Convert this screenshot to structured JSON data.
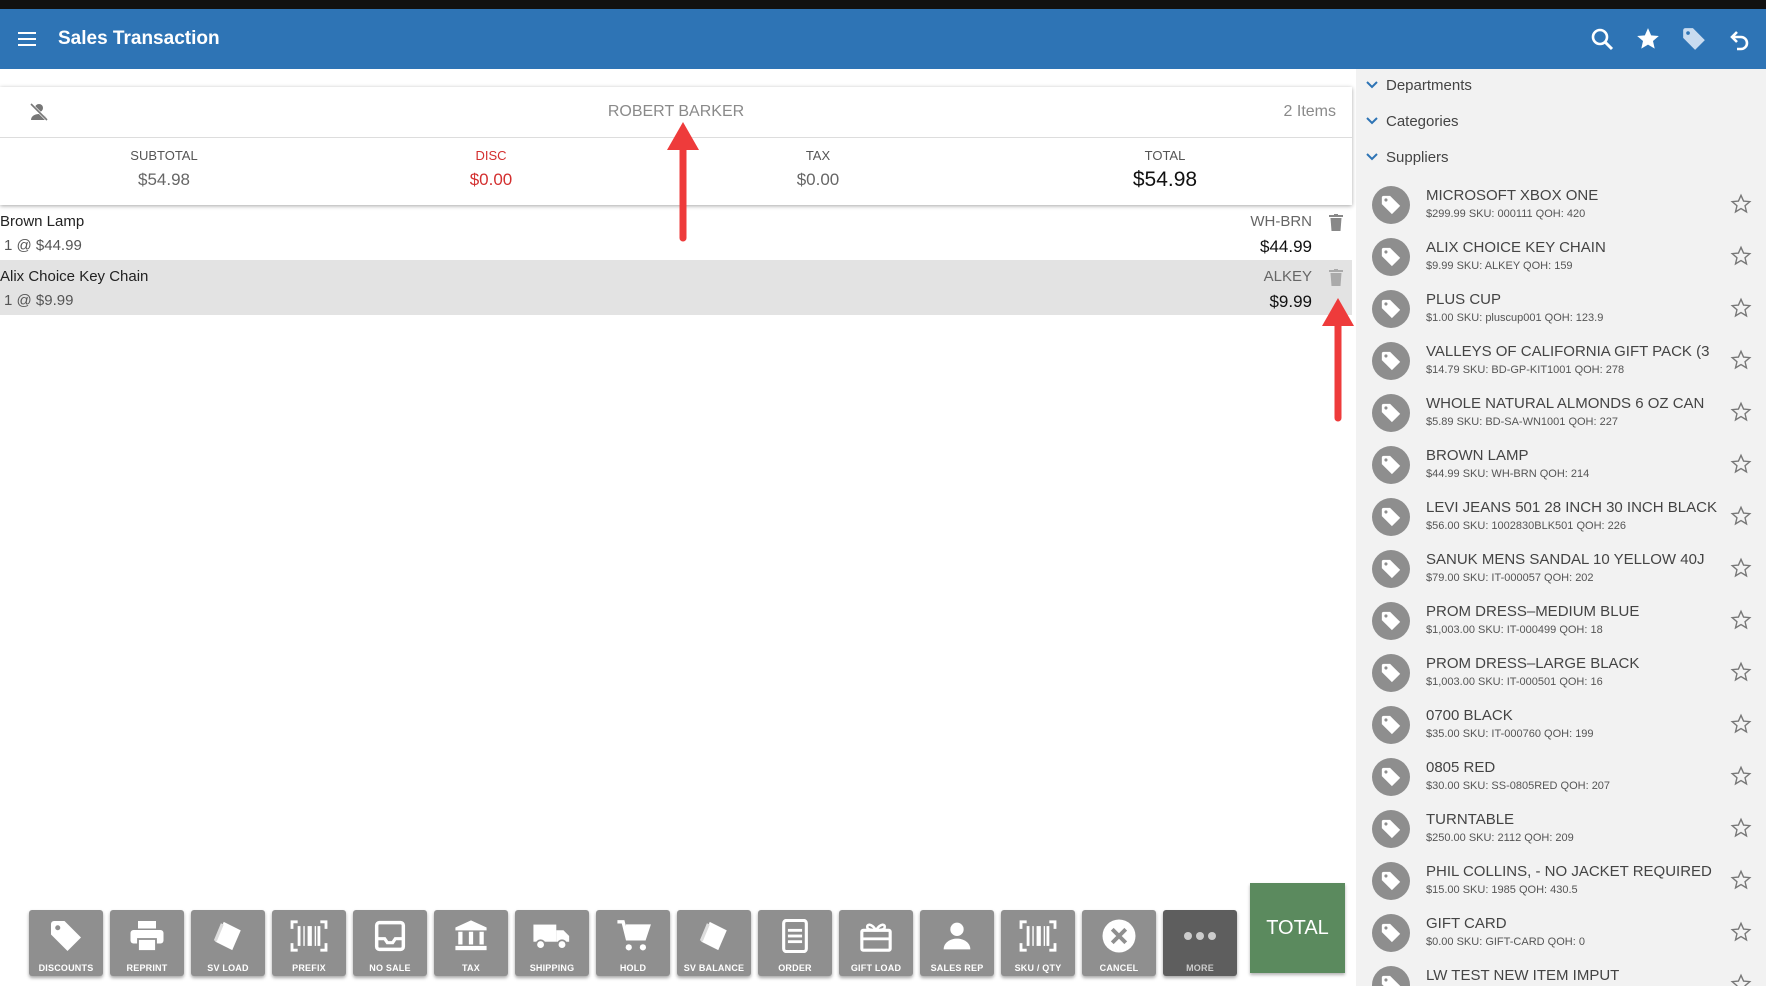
{
  "header": {
    "title": "Sales Transaction",
    "icons": [
      "menu-icon",
      "search-icon",
      "star-icon",
      "tag-icon",
      "undo-icon"
    ]
  },
  "customer": {
    "name": "ROBERT BARKER",
    "item_count": "2 Items"
  },
  "totals": {
    "subtotal_label": "SUBTOTAL",
    "subtotal": "$54.98",
    "disc_label": "DISC",
    "disc": "$0.00",
    "tax_label": "TAX",
    "tax": "$0.00",
    "total_label": "TOTAL",
    "total": "$54.98"
  },
  "lines": [
    {
      "name": "Brown Lamp",
      "qty": "1 @ $44.99",
      "sku": "WH-BRN",
      "price": "$44.99",
      "selected": false
    },
    {
      "name": "Alix Choice Key Chain",
      "qty": "1 @ $9.99",
      "sku": "ALKEY",
      "price": "$9.99",
      "selected": true
    }
  ],
  "toolbar": [
    {
      "label": "DISCOUNTS",
      "icon": "tag-icon"
    },
    {
      "label": "REPRINT",
      "icon": "printer-icon"
    },
    {
      "label": "SV LOAD",
      "icon": "card-icon"
    },
    {
      "label": "PREFIX",
      "icon": "barcode-icon"
    },
    {
      "label": "NO SALE",
      "icon": "tray-icon"
    },
    {
      "label": "TAX",
      "icon": "bank-icon"
    },
    {
      "label": "SHIPPING",
      "icon": "truck-icon"
    },
    {
      "label": "HOLD",
      "icon": "cart-icon"
    },
    {
      "label": "SV BALANCE",
      "icon": "card-icon"
    },
    {
      "label": "ORDER",
      "icon": "document-icon"
    },
    {
      "label": "GIFT LOAD",
      "icon": "gift-icon"
    },
    {
      "label": "SALES REP",
      "icon": "person-icon"
    },
    {
      "label": "SKU / QTY",
      "icon": "barcode-icon"
    },
    {
      "label": "CANCEL",
      "icon": "close-circle-icon"
    },
    {
      "label": "MORE",
      "icon": "more-icon"
    }
  ],
  "total_button": "TOTAL",
  "sidebar": {
    "sections": [
      "Departments",
      "Categories",
      "Suppliers"
    ],
    "products": [
      {
        "name": "MICROSOFT XBOX ONE",
        "detail": "$299.99 SKU: 000111 QOH: 420"
      },
      {
        "name": "ALIX CHOICE KEY CHAIN",
        "detail": "$9.99 SKU: ALKEY QOH: 159"
      },
      {
        "name": "PLUS CUP",
        "detail": "$1.00 SKU: pluscup001 QOH: 123.9"
      },
      {
        "name": "VALLEYS OF CALIFORNIA GIFT PACK (3",
        "detail": "$14.79 SKU: BD-GP-KIT1001 QOH: 278"
      },
      {
        "name": "WHOLE NATURAL ALMONDS 6 OZ CAN",
        "detail": "$5.89 SKU: BD-SA-WN1001 QOH: 227"
      },
      {
        "name": "BROWN LAMP",
        "detail": "$44.99 SKU: WH-BRN QOH: 214"
      },
      {
        "name": "LEVI JEANS 501 28 INCH 30 INCH BLACK",
        "detail": "$56.00 SKU: 1002830BLK501 QOH: 226"
      },
      {
        "name": "SANUK MENS SANDAL 10 YELLOW 40J",
        "detail": "$79.00 SKU: IT-000057 QOH: 202"
      },
      {
        "name": "PROM DRESS–MEDIUM BLUE",
        "detail": "$1,003.00 SKU: IT-000499 QOH: 18"
      },
      {
        "name": "PROM DRESS–LARGE BLACK",
        "detail": "$1,003.00 SKU: IT-000501 QOH: 16"
      },
      {
        "name": "0700 BLACK",
        "detail": "$35.00 SKU: IT-000760 QOH: 199"
      },
      {
        "name": "0805 RED",
        "detail": "$30.00 SKU: SS-0805RED QOH: 207"
      },
      {
        "name": "TURNTABLE",
        "detail": "$250.00 SKU: 2112 QOH: 209"
      },
      {
        "name": "PHIL COLLINS, - NO JACKET REQUIRED",
        "detail": "$15.00 SKU: 1985 QOH: 430.5"
      },
      {
        "name": "GIFT CARD",
        "detail": "$0.00 SKU: GIFT-CARD QOH: 0"
      },
      {
        "name": "LW TEST NEW ITEM IMPUT",
        "detail": ""
      }
    ]
  },
  "colors": {
    "appbar": "#2e74b5",
    "discount": "#d32f2f",
    "total_button": "#5b8a5e",
    "annotation_arrow": "#ee3b3b"
  }
}
